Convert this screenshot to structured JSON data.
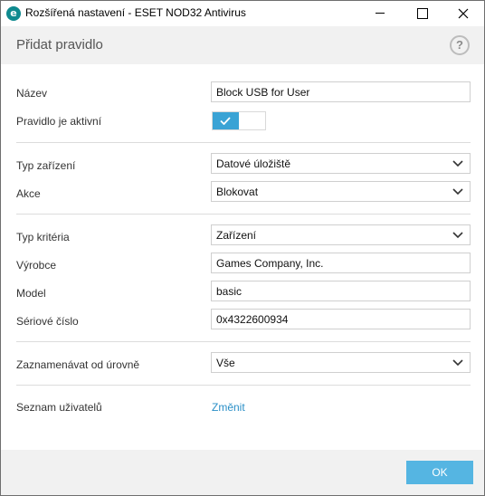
{
  "window": {
    "title": "Rozšířená nastavení - ESET NOD32 Antivirus",
    "app_icon_letter": "e"
  },
  "header": {
    "title": "Přidat pravidlo",
    "help_symbol": "?"
  },
  "form": {
    "name_label": "Název",
    "name_value": "Block USB for User",
    "active_label": "Pravidlo je aktivní",
    "active_value": true,
    "device_type_label": "Typ zařízení",
    "device_type_value": "Datové úložiště",
    "action_label": "Akce",
    "action_value": "Blokovat",
    "criteria_type_label": "Typ kritéria",
    "criteria_type_value": "Zařízení",
    "vendor_label": "Výrobce",
    "vendor_value": "Games Company, Inc.",
    "model_label": "Model",
    "model_value": "basic",
    "serial_label": "Sériové číslo",
    "serial_value": "0x4322600934",
    "log_level_label": "Zaznamenávat od úrovně",
    "log_level_value": "Vše",
    "user_list_label": "Seznam uživatelů",
    "user_list_link": "Změnit"
  },
  "footer": {
    "ok_label": "OK"
  },
  "colors": {
    "accent": "#3aa3d5",
    "ok_button": "#55b5e2",
    "link": "#2a8fc7",
    "header_bg": "#f1f1f1"
  }
}
